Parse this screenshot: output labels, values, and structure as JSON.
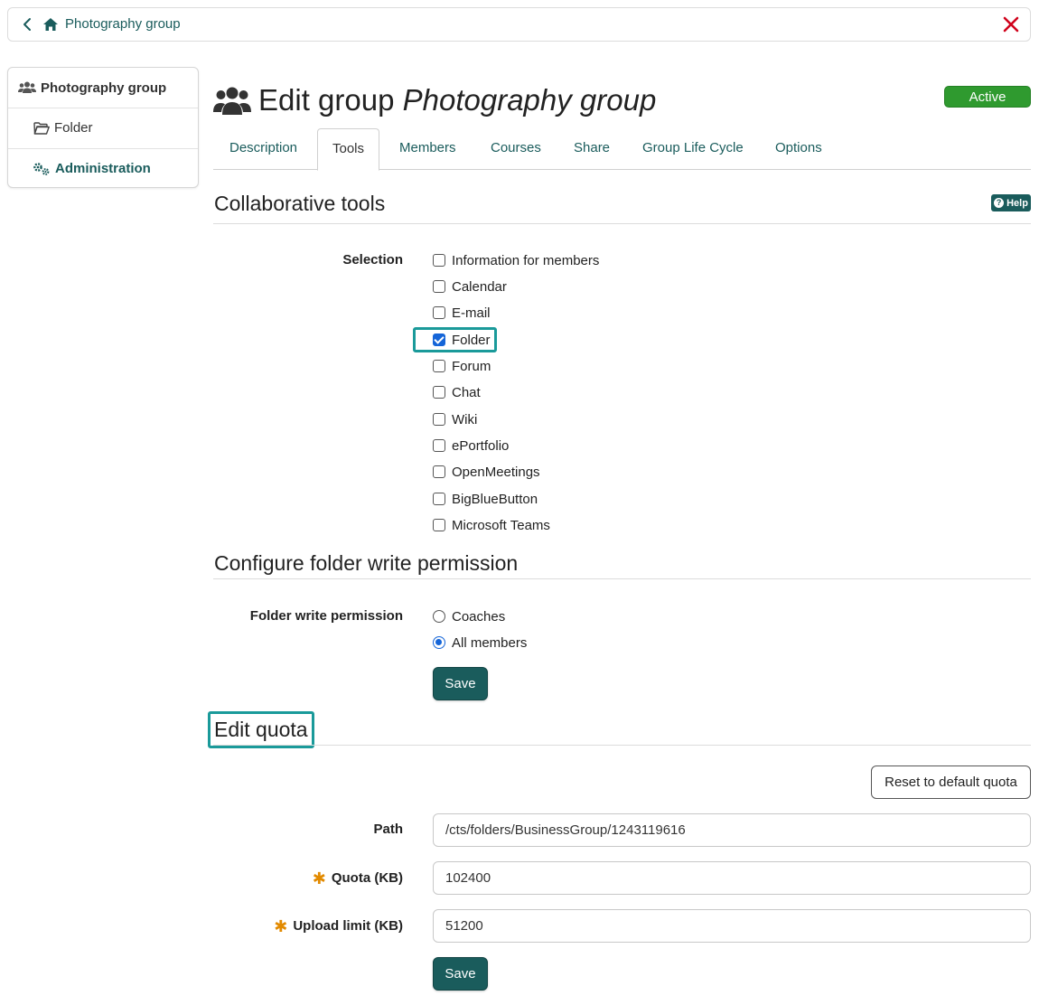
{
  "breadcrumb": {
    "home_label": "Photography group"
  },
  "sidebar": {
    "items": [
      {
        "label": "Photography group",
        "icon": "users-icon"
      },
      {
        "label": "Folder",
        "icon": "folder-open-icon"
      },
      {
        "label": "Administration",
        "icon": "gears-icon"
      }
    ]
  },
  "header": {
    "title_prefix": "Edit group",
    "title_group": "Photography group",
    "status": "Active",
    "status_color": "#2f9a2f"
  },
  "tabs": [
    {
      "label": "Description",
      "active": false
    },
    {
      "label": "Tools",
      "active": true
    },
    {
      "label": "Members",
      "active": false
    },
    {
      "label": "Courses",
      "active": false
    },
    {
      "label": "Share",
      "active": false
    },
    {
      "label": "Group Life Cycle",
      "active": false
    },
    {
      "label": "Options",
      "active": false
    }
  ],
  "collab": {
    "title": "Collaborative tools",
    "help_label": "Help",
    "selection_label": "Selection",
    "tools": [
      {
        "label": "Information for members",
        "checked": false
      },
      {
        "label": "Calendar",
        "checked": false
      },
      {
        "label": "E-mail",
        "checked": false
      },
      {
        "label": "Folder",
        "checked": true
      },
      {
        "label": "Forum",
        "checked": false
      },
      {
        "label": "Chat",
        "checked": false
      },
      {
        "label": "Wiki",
        "checked": false
      },
      {
        "label": "ePortfolio",
        "checked": false
      },
      {
        "label": "OpenMeetings",
        "checked": false
      },
      {
        "label": "BigBlueButton",
        "checked": false
      },
      {
        "label": "Microsoft Teams",
        "checked": false
      }
    ]
  },
  "folder_perm": {
    "title": "Configure folder write permission",
    "label": "Folder write permission",
    "options": [
      {
        "label": "Coaches",
        "selected": false
      },
      {
        "label": "All members",
        "selected": true
      }
    ],
    "save_label": "Save"
  },
  "quota": {
    "title": "Edit quota",
    "reset_label": "Reset to default quota",
    "path_label": "Path",
    "path_value": "/cts/folders/BusinessGroup/1243119616",
    "quota_label": "Quota (KB)",
    "quota_value": "102400",
    "upload_label": "Upload limit (KB)",
    "upload_value": "51200",
    "save_label": "Save"
  },
  "colors": {
    "accent": "#1a5c5c",
    "highlight": "#1a9a9a",
    "required": "#e28a00",
    "close": "#d0021b"
  }
}
